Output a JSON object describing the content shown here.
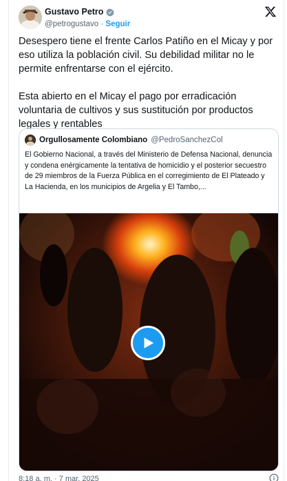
{
  "tweet": {
    "author_name": "Gustavo Petro",
    "author_handle": "@petrogustavo",
    "separator": "·",
    "follow_label": "Seguir",
    "paragraph_1": "Desespero tiene el frente Carlos Patiño en el Micay y por eso utiliza la población civil. Su debilidad militar no le permite enfrentarse con el ejército.",
    "paragraph_2": "Esta abierto en el Micay el pago por erradicación voluntaria de cultivos y sus sustitución por productos legales y rentables",
    "timestamp": "8:18 a. m. · 7 mar. 2025"
  },
  "quoted": {
    "author_name": "Orgullosamente Colombiano",
    "author_handle": "@PedroSanchezCol",
    "text": "El Gobierno Nacional, a través del Ministerio de Defensa Nacional, denuncia y condena enérgicamente la tentativa de homicidio y el posterior secuestro de 29 miembros de la Fuerza Pública en el corregimiento de El Plateado y La Hacienda, en los municipios de Argelia y El Tambo,..."
  },
  "icons": {
    "verified": "verified-badge-icon",
    "logo": "x-logo-icon",
    "play": "play-icon",
    "info": "info-icon"
  },
  "colors": {
    "accent": "#1d9bf0",
    "text": "#0f1419",
    "muted": "#536471",
    "border": "#cfd9de"
  }
}
